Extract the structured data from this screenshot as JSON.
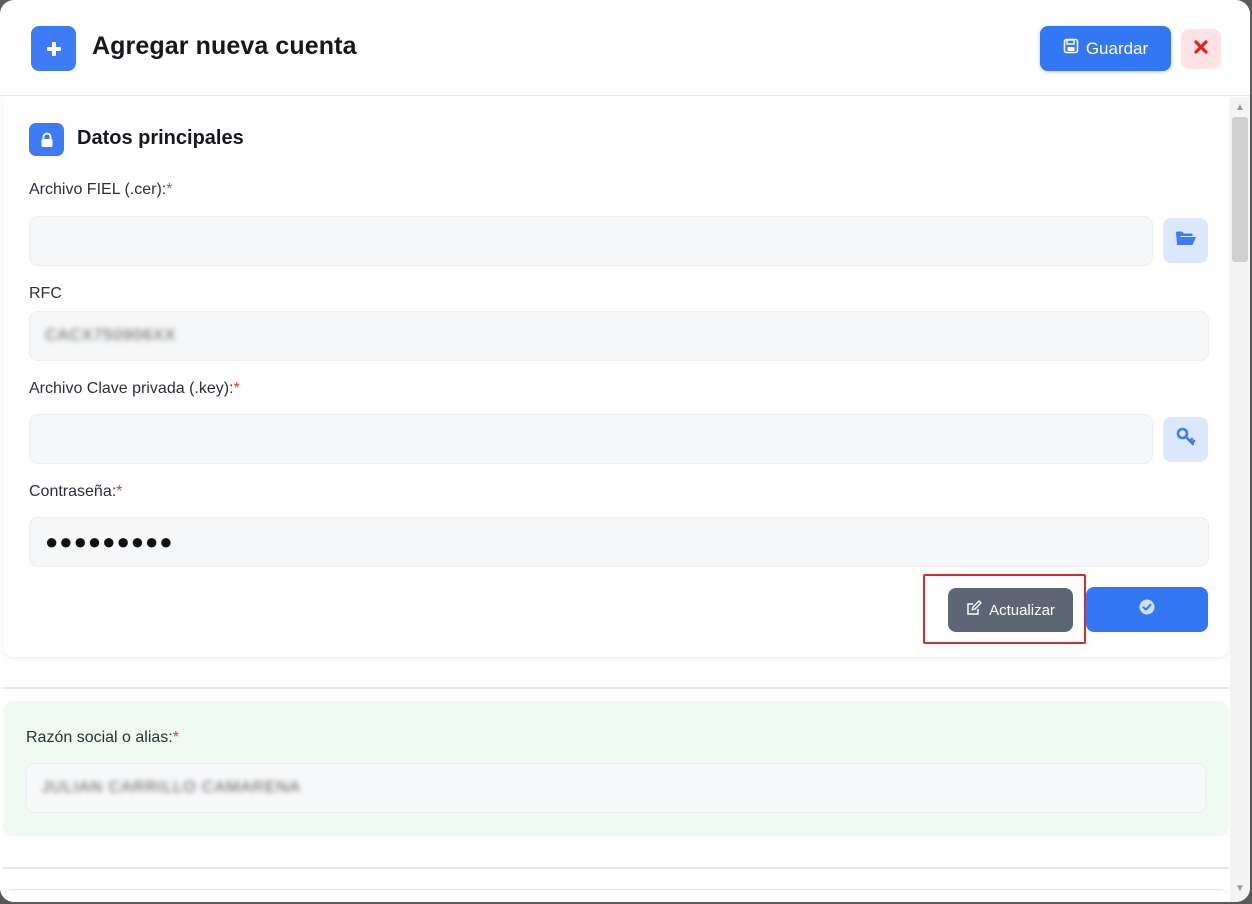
{
  "header": {
    "title": "Agregar nueva cuenta",
    "save_label": "Guardar"
  },
  "section": {
    "title": "Datos principales"
  },
  "fields": {
    "fiel": {
      "label": "Archivo FIEL (.cer):",
      "required": "*",
      "value": ""
    },
    "rfc": {
      "label": "RFC",
      "value": "CACX750906XX"
    },
    "key": {
      "label": "Archivo Clave privada (.key):",
      "required": "*",
      "value": ""
    },
    "password": {
      "label": "Contraseña:",
      "required": "*",
      "value": "●●●●●●●●●"
    },
    "alias": {
      "label": "Razón social o alias:",
      "required": "*",
      "value": "JULIAN CARRILLO CAMARENA"
    }
  },
  "actions": {
    "update_label": "Actualizar"
  },
  "colors": {
    "primary": "#3377f2",
    "danger": "#e03a3a",
    "update": "#5d6674",
    "green_panel": "#effaf2"
  }
}
